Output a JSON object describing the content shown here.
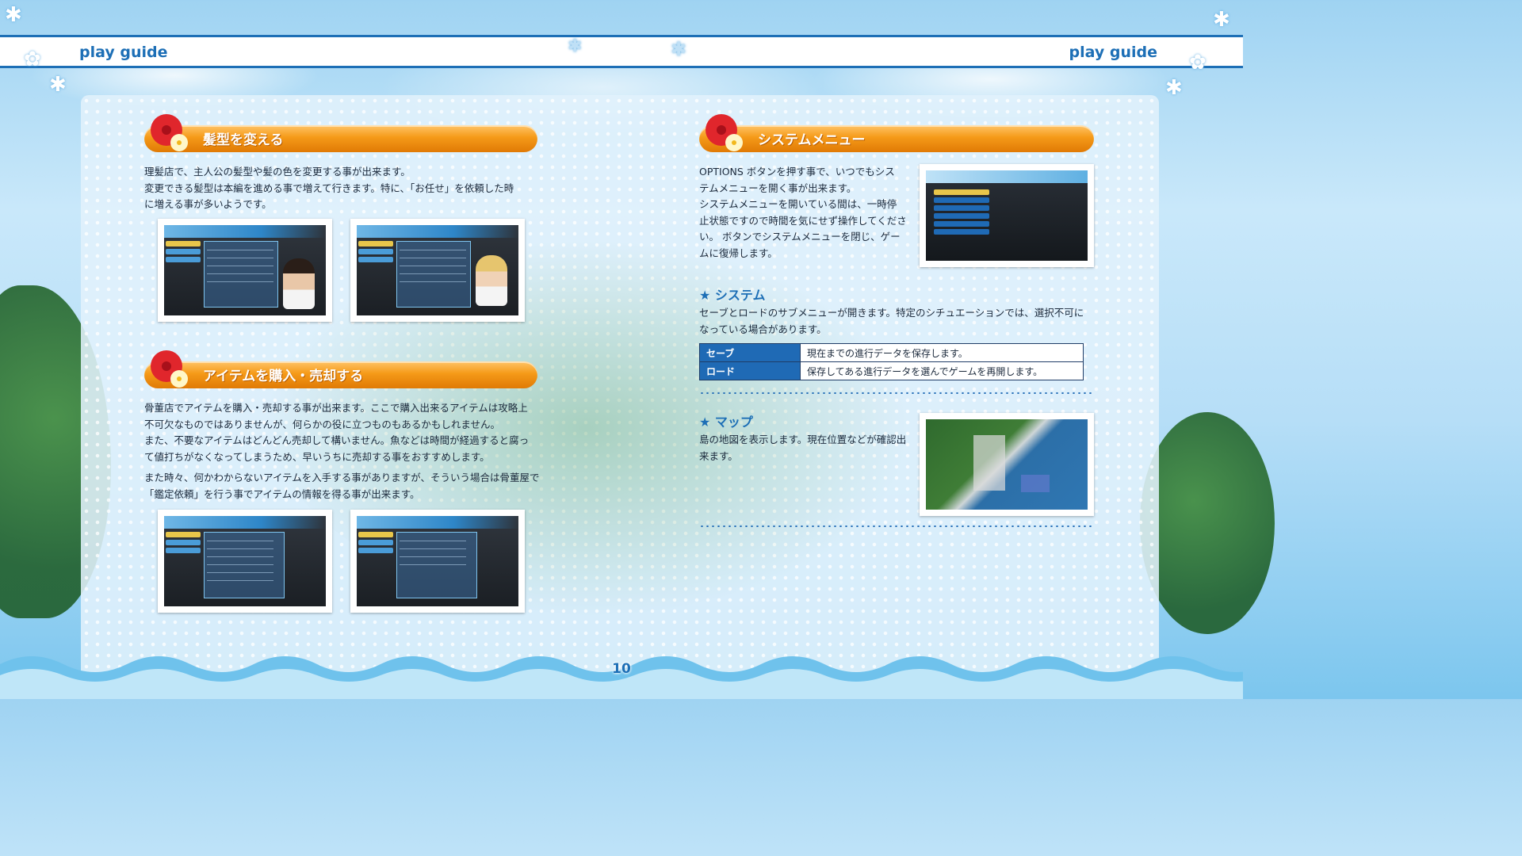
{
  "header": {
    "left_label": "play guide",
    "right_label": "play guide"
  },
  "left": {
    "sections": [
      {
        "title": "髪型を変える",
        "paragraphs": [
          "理髪店で、主人公の髪型や髪の色を変更する事が出来ます。",
          "変更できる髪型は本編を進める事で増えて行きます。特に、「お任せ」を依頼した時",
          "に増える事が多いようです。"
        ]
      },
      {
        "title": "アイテムを購入・売却する",
        "paragraphs": [
          "骨董店でアイテムを購入・売却する事が出来ます。ここで購入出来るアイテムは攻略上",
          "不可欠なものではありませんが、何らかの役に立つものもあるかもしれません。",
          "また、不要なアイテムはどんどん売却して構いません。魚などは時間が経過すると腐っ",
          "て値打ちがなくなってしまうため、早いうちに売却する事をおすすめします。",
          "また時々、何かわからないアイテムを入手する事がありますが、そういう場合は骨董屋で",
          "「鑑定依頼」を行う事でアイテムの情報を得る事が出来ます。"
        ]
      }
    ]
  },
  "right": {
    "system_menu": {
      "title": "システムメニュー",
      "paragraphs": [
        "OPTIONS ボタンを押す事で、いつでもシス",
        "テムメニューを開く事が出来ます。",
        "システムメニューを開いている間は、一時停",
        "止状態ですので時間を気にせず操作してくださ",
        "い。 ボタンでシステムメニューを閉じ、ゲー",
        "ムに復帰します。"
      ]
    },
    "system": {
      "title": "システム",
      "paragraphs": [
        "セーブとロードのサブメニューが開きます。特定のシチュエーションでは、選択不可に",
        "なっている場合があります。"
      ],
      "table": [
        {
          "key": "セーブ",
          "value": "現在までの進行データを保存します。"
        },
        {
          "key": "ロード",
          "value": "保存してある進行データを選んでゲームを再開します。"
        }
      ]
    },
    "map": {
      "title": "マップ",
      "paragraphs": [
        "島の地図を表示します。現在位置などが確認出",
        "来ます。"
      ]
    }
  },
  "page_number": "10",
  "colors": {
    "accent_blue": "#1d6fb6",
    "heading_orange": "#f59a18",
    "table_key_bg": "#1f6ab5"
  }
}
